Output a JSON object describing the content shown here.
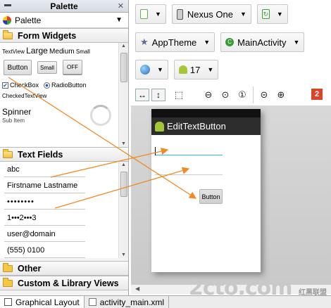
{
  "palette": {
    "title": "Palette",
    "selector_label": "Palette",
    "categories": {
      "form_widgets": "Form Widgets",
      "text_fields": "Text Fields",
      "other": "Other",
      "custom_library": "Custom & Library Views"
    },
    "form_widgets": {
      "textview": "TextView",
      "large": "Large",
      "medium": "Medium",
      "small": "Small",
      "button": "Button",
      "small_button": "Small",
      "toggle_off": "OFF",
      "checkbox": "CheckBox",
      "radio": "RadioButton",
      "checked_textview": "CheckedTextView",
      "spinner": "Spinner",
      "sub_item": "Sub Item"
    },
    "text_fields": [
      "abc",
      "Firstname Lastname",
      "••••••••",
      "1•••2•••3",
      "user@domain",
      "(555) 0100"
    ]
  },
  "toolbar": {
    "device": "Nexus One",
    "theme": "AppTheme",
    "activity": "MainActivity",
    "api": "17",
    "error_count": "2"
  },
  "preview": {
    "app_title": "EditTextButton",
    "button_label": "Button"
  },
  "tabs": {
    "graphical": "Graphical Layout",
    "xml": "activity_main.xml"
  },
  "watermark": {
    "main": "2cto.com",
    "small": "红黑联盟"
  },
  "colors": {
    "arrow": "#f08a24",
    "action_bar": "#2d2d2d",
    "error": "#d9442b",
    "android_green": "#a4c639"
  }
}
